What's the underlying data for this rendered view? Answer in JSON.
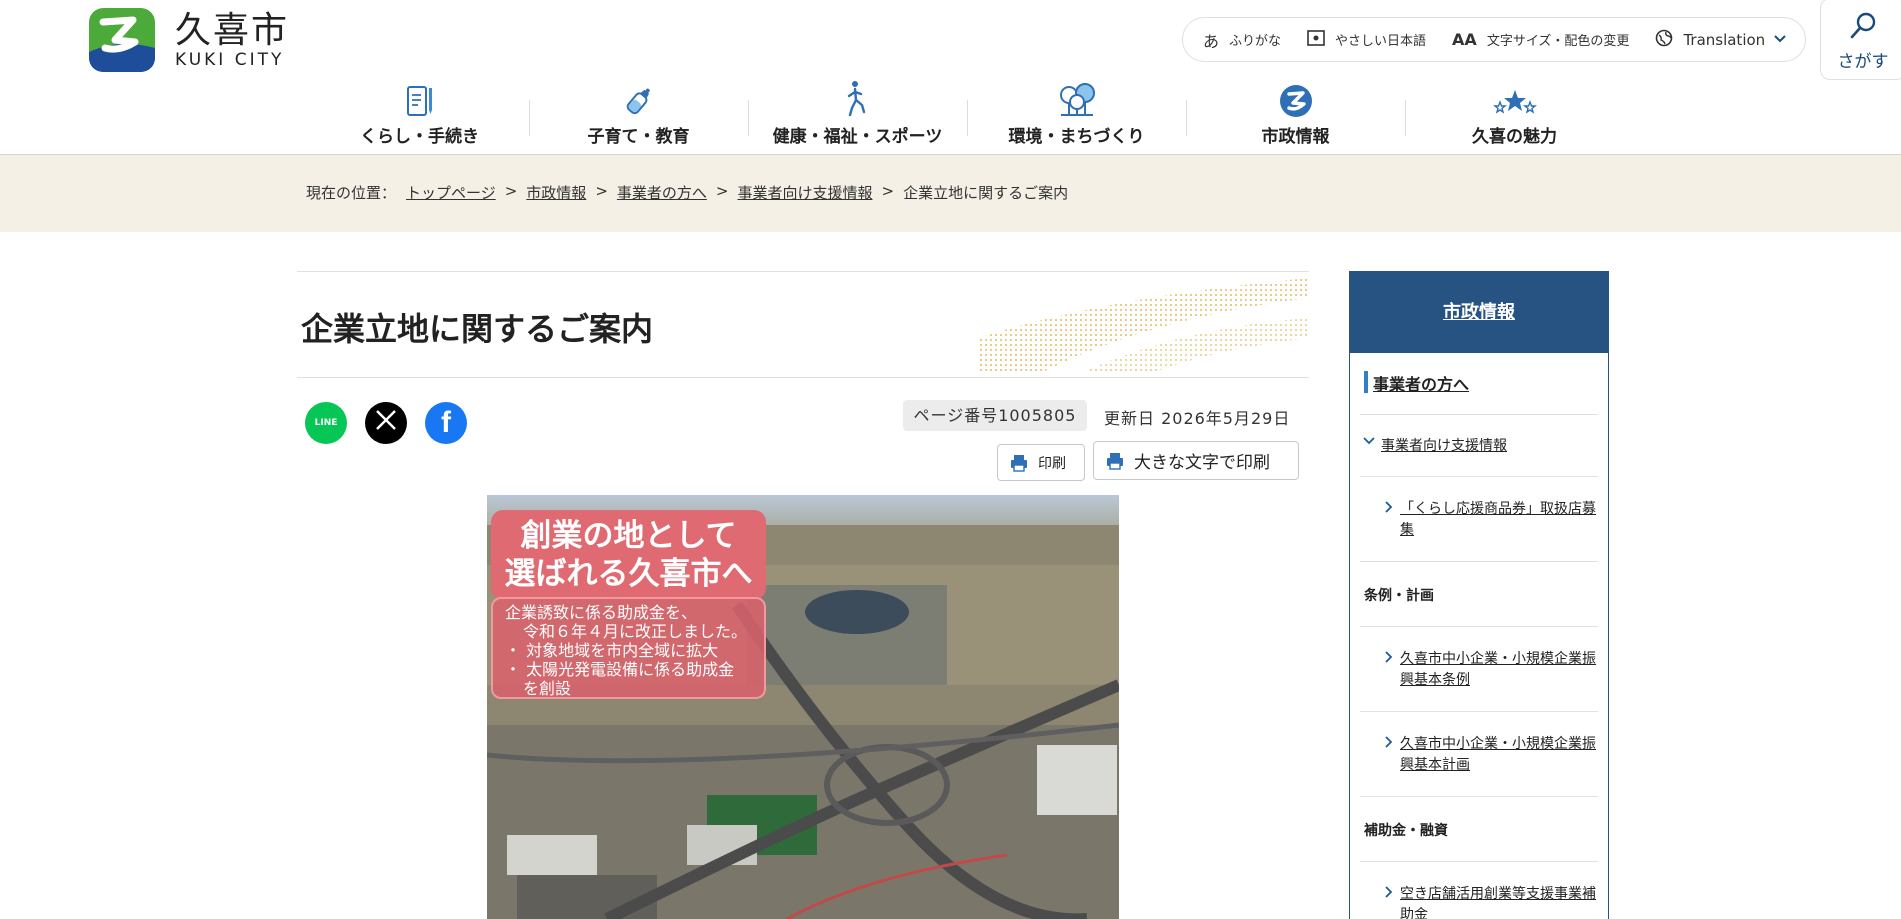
{
  "site": {
    "name_jp": "久喜市",
    "name_en": "KUKI CITY"
  },
  "utility": {
    "furigana": "ふりがな",
    "easy_japanese": "やさしい日本語",
    "text_size": "文字サイズ・配色の変更",
    "translation": "Translation",
    "search_label": "さがす"
  },
  "gnav": [
    {
      "label": "くらし・手続き",
      "icon": "document-pen-icon"
    },
    {
      "label": "子育て・教育",
      "icon": "baby-bottle-icon"
    },
    {
      "label": "健康・福祉・スポーツ",
      "icon": "runner-icon"
    },
    {
      "label": "環境・まちづくり",
      "icon": "trees-icon"
    },
    {
      "label": "市政情報",
      "icon": "city-emblem-icon"
    },
    {
      "label": "久喜の魅力",
      "icon": "stars-icon"
    }
  ],
  "breadcrumb": {
    "prefix": "現在の位置：",
    "items": [
      "トップページ",
      "市政情報",
      "事業者の方へ",
      "事業者向け支援情報"
    ],
    "current": "企業立地に関するご案内",
    "sep": ">"
  },
  "page": {
    "title": "企業立地に関するご案内",
    "page_number": "ページ番号1005805",
    "updated": "更新日 2026年5月29日",
    "print": "印刷",
    "print_large": "大きな文字で印刷"
  },
  "sns": {
    "line_label": "LINE"
  },
  "hero": {
    "headline_1": "創業の地として",
    "headline_2": "選ばれる久喜市へ",
    "body_1": "企業誘致に係る助成金を、",
    "body_2": "令和６年４月に改正しました。",
    "body_3": "・ 対象地域を市内全域に拡大",
    "body_4": "・ 太陽光発電設備に係る助成金",
    "body_5": "を創設"
  },
  "sidebar": {
    "heading": "市政情報",
    "level1": "事業者の方へ",
    "level2": "事業者向け支援情報",
    "link_1": "「くらし応援商品券」取扱店募集",
    "cat_1": "条例・計画",
    "link_2": "久喜市中小企業・小規模企業振興基本条例",
    "link_3": "久喜市中小企業・小規模企業振興基本計画",
    "cat_2": "補助金・融資",
    "link_4": "空き店舗活用創業等支援事業補助金"
  },
  "colors": {
    "navy": "#275382",
    "beige_band": "#f5f0e6",
    "hero_pink": "#e06a72",
    "line_green": "#06c755",
    "facebook_blue": "#1877f2"
  }
}
